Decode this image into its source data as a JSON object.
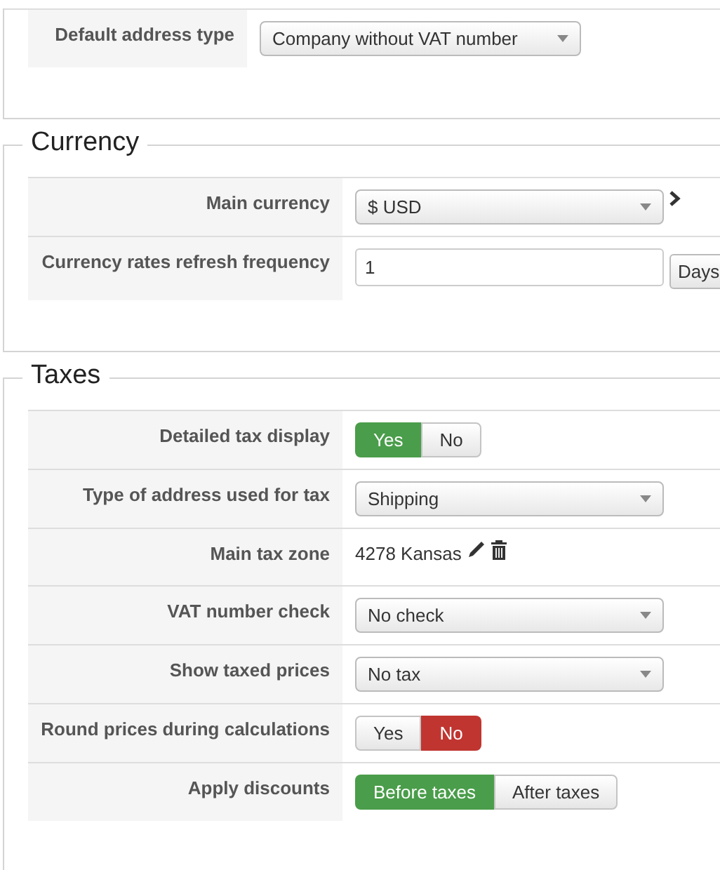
{
  "sections": [
    {
      "rows": [
        {
          "label": "Default address type",
          "kind": "select",
          "value": "Company without VAT number"
        }
      ]
    },
    {
      "legend": "Currency",
      "rows": [
        {
          "label": "Main currency",
          "kind": "select",
          "value": "$ USD",
          "chevron": true
        },
        {
          "label": "Currency rates refresh frequency",
          "kind": "input",
          "value": "1",
          "addon": "Days"
        }
      ]
    },
    {
      "legend": "Taxes",
      "rows": [
        {
          "label": "Detailed tax display",
          "kind": "toggle",
          "options": [
            {
              "label": "Yes",
              "selected": true,
              "color": "#4a9d4a"
            },
            {
              "label": "No",
              "selected": false
            }
          ]
        },
        {
          "label": "Type of address used for tax",
          "kind": "select",
          "value": "Shipping"
        },
        {
          "label": "Main tax zone",
          "kind": "text",
          "value": "4278 Kansas",
          "actions": true
        },
        {
          "label": "VAT number check",
          "kind": "select",
          "value": "No check"
        },
        {
          "label": "Show taxed prices",
          "kind": "select",
          "value": "No tax"
        },
        {
          "label": "Round prices during calculations",
          "kind": "toggle",
          "options": [
            {
              "label": "Yes",
              "selected": false
            },
            {
              "label": "No",
              "selected": true,
              "color": "#c03530"
            }
          ]
        },
        {
          "label": "Apply discounts",
          "kind": "toggle",
          "options": [
            {
              "label": "Before taxes",
              "selected": true,
              "color": "#4a9d4a"
            },
            {
              "label": "After taxes",
              "selected": false
            }
          ]
        }
      ]
    }
  ]
}
